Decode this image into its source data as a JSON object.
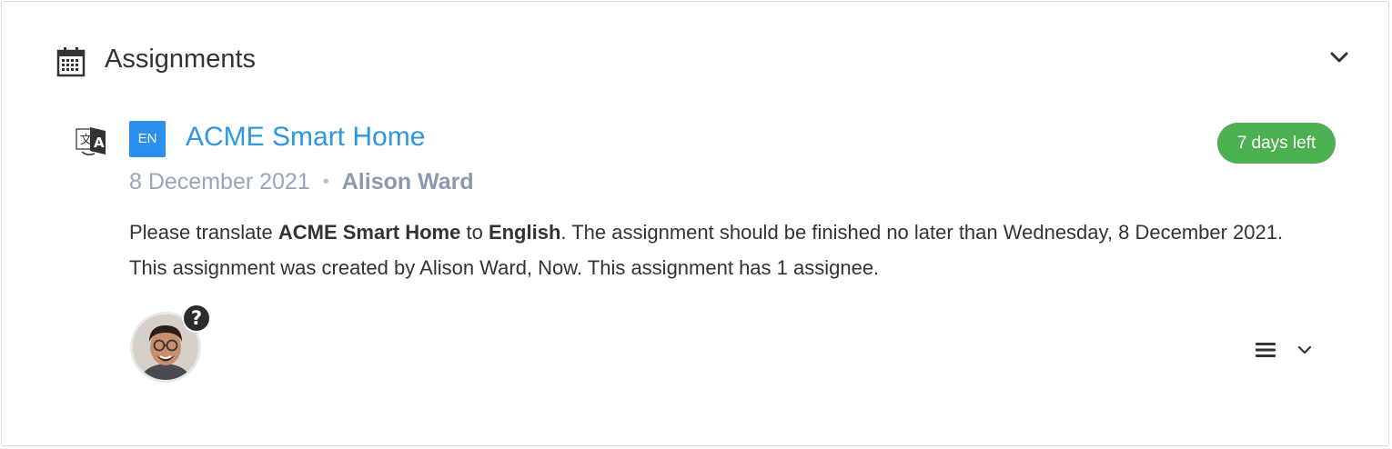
{
  "section": {
    "title": "Assignments",
    "icons": {
      "header": "calendar-icon",
      "collapse": "chevron-down-icon"
    }
  },
  "assignment": {
    "type_icon": "translate-icon",
    "language_badge": "EN",
    "title": "ACME Smart Home",
    "days_left": "7 days left",
    "date": "8 December 2021",
    "separator": "•",
    "author": "Alison Ward",
    "description": {
      "prefix": "Please translate ",
      "project": "ACME Smart Home",
      "middle": " to ",
      "language": "English",
      "suffix": ". The assignment should be finished no later than Wednesday, 8 December 2021. This assignment was created by Alison Ward, Now. This assignment has 1 assignee."
    },
    "assignee": {
      "avatar": "avatar",
      "status_icon": "question-circle-icon"
    },
    "actions": {
      "menu_icon": "menu-icon",
      "dropdown_icon": "chevron-down-icon"
    }
  },
  "colors": {
    "link": "#2d97e0",
    "badge_blue": "#2b8ff0",
    "badge_green": "#4caf50",
    "meta_text": "#9aa5b8"
  }
}
